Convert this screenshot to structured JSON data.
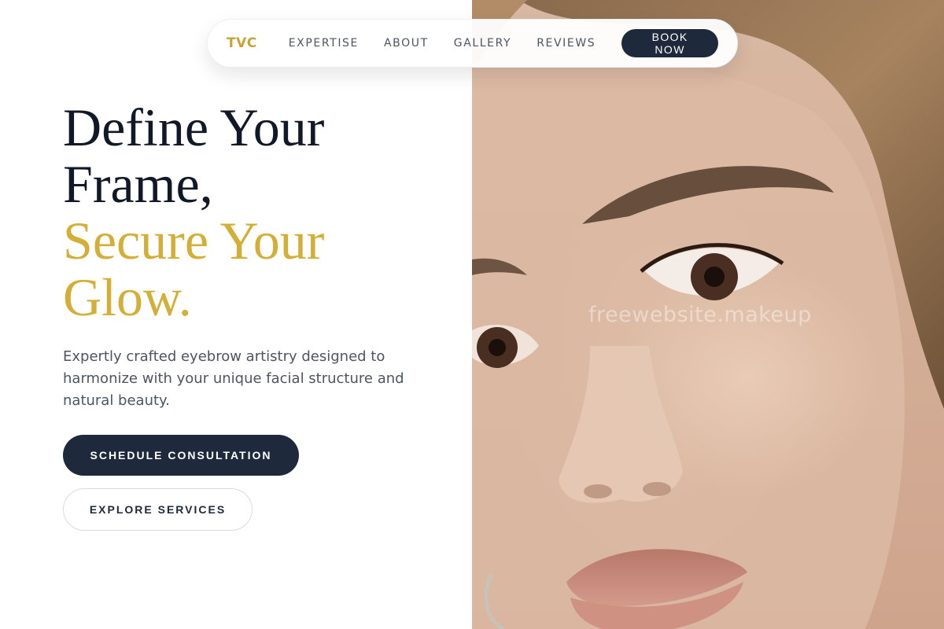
{
  "nav": {
    "logo": "TVC",
    "links": [
      "EXPERTISE",
      "ABOUT",
      "GALLERY",
      "REVIEWS"
    ],
    "book_label": "BOOK NOW"
  },
  "hero": {
    "headline_dark": [
      "Define Your",
      "Frame,"
    ],
    "headline_gold": [
      "Secure Your",
      "Glow."
    ],
    "lead": "Expertly crafted eyebrow artistry designed to harmonize with your unique facial structure and natural beauty.",
    "primary_cta": "SCHEDULE CONSULTATION",
    "secondary_cta": "EXPLORE SERVICES"
  },
  "photo": {
    "watermark": "freewebsite.makeup"
  },
  "colors": {
    "accent_gold": "#d4af37",
    "navy": "#1e293b",
    "heading": "#111827",
    "body_text": "#4b5563"
  }
}
